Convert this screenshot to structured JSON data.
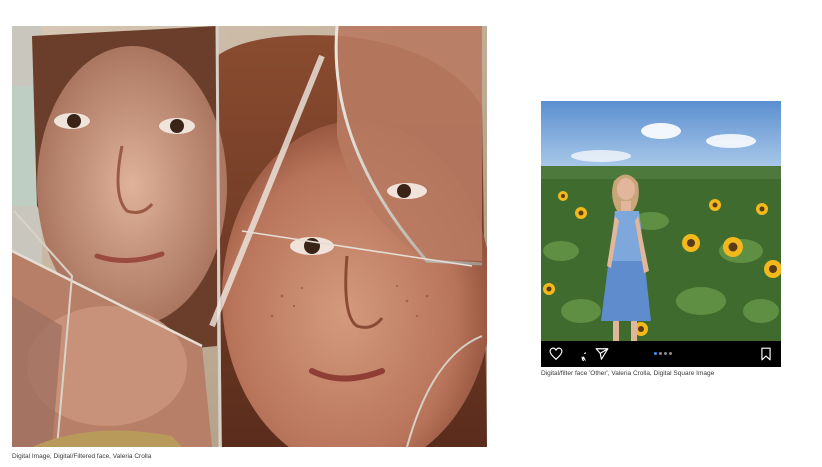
{
  "artworks": {
    "main": {
      "caption": "Digital Image, Digital/Filtered face, Valeria Crolla"
    },
    "post": {
      "caption": "Digital/filter face 'Other', Valeria Crolla, Digital Square Image",
      "actions": {
        "like_icon": "heart-icon",
        "comment_icon": "comment-icon",
        "share_icon": "send-icon",
        "save_icon": "bookmark-icon"
      },
      "carousel": {
        "total": 4,
        "active": 1
      },
      "colors": {
        "bar": "#000000",
        "active_dot": "#3d8bff"
      }
    }
  }
}
